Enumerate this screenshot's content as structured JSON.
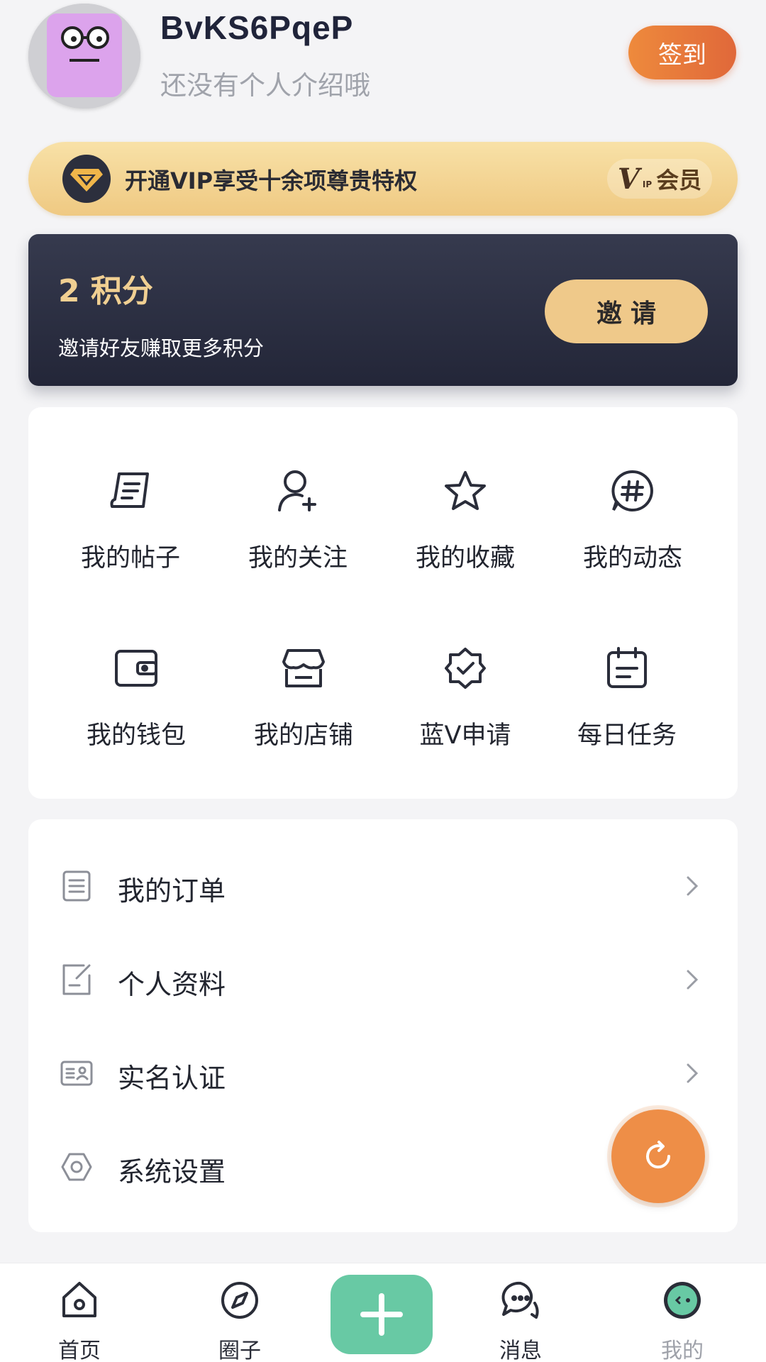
{
  "profile": {
    "username": "BvKS6PqeP",
    "bio": "还没有个人介绍哦",
    "signin_label": "签到"
  },
  "vip": {
    "text": "开通VIP享受十余项尊贵特权",
    "badge_v": "V",
    "badge_small": "IP",
    "badge_label": "会员"
  },
  "points": {
    "value": "2 积分",
    "subtitle": "邀请好友赚取更多积分",
    "invite_label": "邀请"
  },
  "grid": [
    {
      "label": "我的帖子",
      "icon": "post-icon"
    },
    {
      "label": "我的关注",
      "icon": "follow-icon"
    },
    {
      "label": "我的收藏",
      "icon": "star-icon"
    },
    {
      "label": "我的动态",
      "icon": "hashtag-icon"
    },
    {
      "label": "我的钱包",
      "icon": "wallet-icon"
    },
    {
      "label": "我的店铺",
      "icon": "shop-icon"
    },
    {
      "label": "蓝V申请",
      "icon": "verified-badge-icon"
    },
    {
      "label": "每日任务",
      "icon": "calendar-icon"
    }
  ],
  "menu": [
    {
      "label": "我的订单",
      "icon": "order-icon"
    },
    {
      "label": "个人资料",
      "icon": "edit-profile-icon"
    },
    {
      "label": "实名认证",
      "icon": "id-card-icon"
    },
    {
      "label": "系统设置",
      "icon": "settings-icon"
    }
  ],
  "tabbar": [
    {
      "label": "首页",
      "icon": "home-icon"
    },
    {
      "label": "圈子",
      "icon": "compass-icon"
    },
    {
      "label": "消息",
      "icon": "chat-icon"
    },
    {
      "label": "我的",
      "icon": "me-icon"
    }
  ],
  "colors": {
    "accent_orange": "#e0683a",
    "vip_gold": "#efc982",
    "points_dark": "#232638",
    "post_green": "#68c9a4"
  }
}
